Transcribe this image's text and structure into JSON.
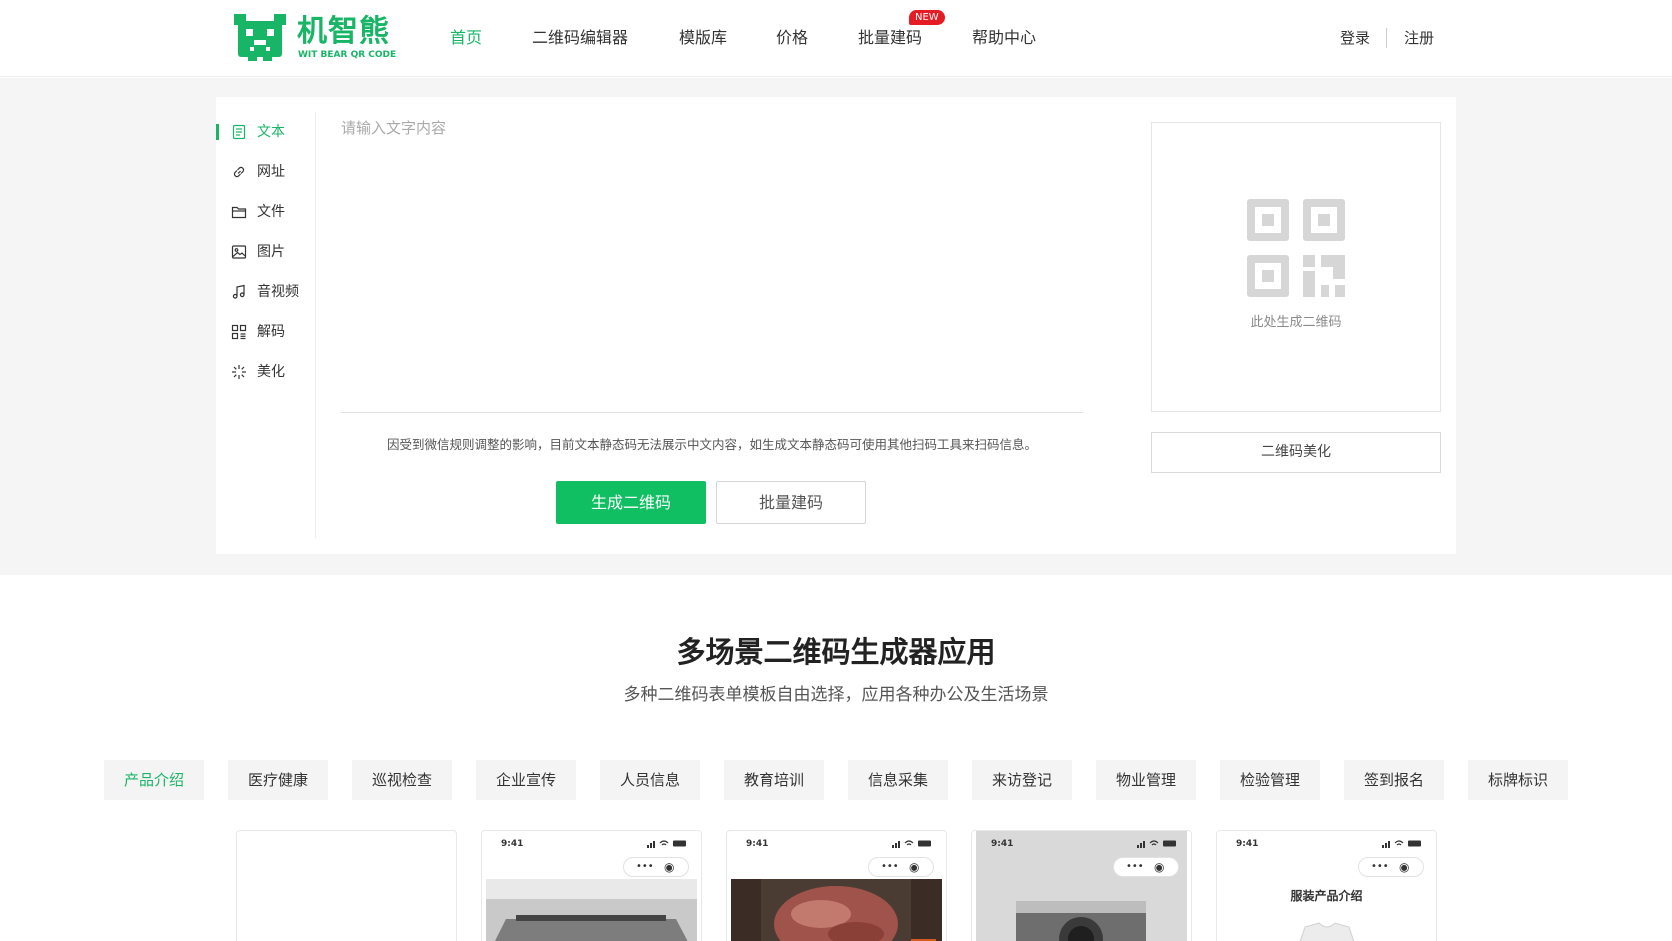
{
  "brand": {
    "name": "机智熊",
    "subtitle": "WIT BEAR QR CODE",
    "accent_color": "#18b566",
    "logo_icon": "bear-qr-logo"
  },
  "nav": {
    "items": [
      {
        "label": "首页",
        "active": true
      },
      {
        "label": "二维码编辑器"
      },
      {
        "label": "模版库"
      },
      {
        "label": "价格"
      },
      {
        "label": "批量建码",
        "badge": "NEW"
      },
      {
        "label": "帮助中心"
      }
    ],
    "login": "登录",
    "register": "注册",
    "badge_color": "#e51c23"
  },
  "sidebar": {
    "items": [
      {
        "label": "文本",
        "icon": "document-icon",
        "active": true
      },
      {
        "label": "网址",
        "icon": "link-icon"
      },
      {
        "label": "文件",
        "icon": "folder-icon"
      },
      {
        "label": "图片",
        "icon": "image-icon"
      },
      {
        "label": "音视频",
        "icon": "music-icon"
      },
      {
        "label": "解码",
        "icon": "qr-scan-icon"
      },
      {
        "label": "美化",
        "icon": "sparkle-icon"
      }
    ]
  },
  "editor": {
    "placeholder": "请输入文字内容",
    "notice": "因受到微信规则调整的影响，目前文本静态码无法展示中文内容，如生成文本静态码可使用其他扫码工具来扫码信息。",
    "generate_button": "生成二维码",
    "batch_button": "批量建码",
    "primary_color": "#0fbf61"
  },
  "preview": {
    "caption": "此处生成二维码",
    "beautify_button": "二维码美化",
    "placeholder_icon": "qr-placeholder-icon"
  },
  "templates": {
    "title": "多场景二维码生成器应用",
    "subtitle": "多种二维码表单模板自由选择，应用各种办公及生活场景",
    "categories": [
      {
        "label": "产品介绍",
        "active": true
      },
      {
        "label": "医疗健康"
      },
      {
        "label": "巡视检查"
      },
      {
        "label": "企业宣传"
      },
      {
        "label": "人员信息"
      },
      {
        "label": "教育培训"
      },
      {
        "label": "信息采集"
      },
      {
        "label": "来访登记"
      },
      {
        "label": "物业管理"
      },
      {
        "label": "检验管理"
      },
      {
        "label": "签到报名"
      },
      {
        "label": "标牌标识"
      }
    ],
    "cards": [
      {
        "time": "",
        "title": ""
      },
      {
        "time": "9:41",
        "title": ""
      },
      {
        "time": "9:41",
        "title": ""
      },
      {
        "time": "9:41",
        "title": ""
      },
      {
        "time": "9:41",
        "title": "服装产品介绍"
      }
    ]
  }
}
